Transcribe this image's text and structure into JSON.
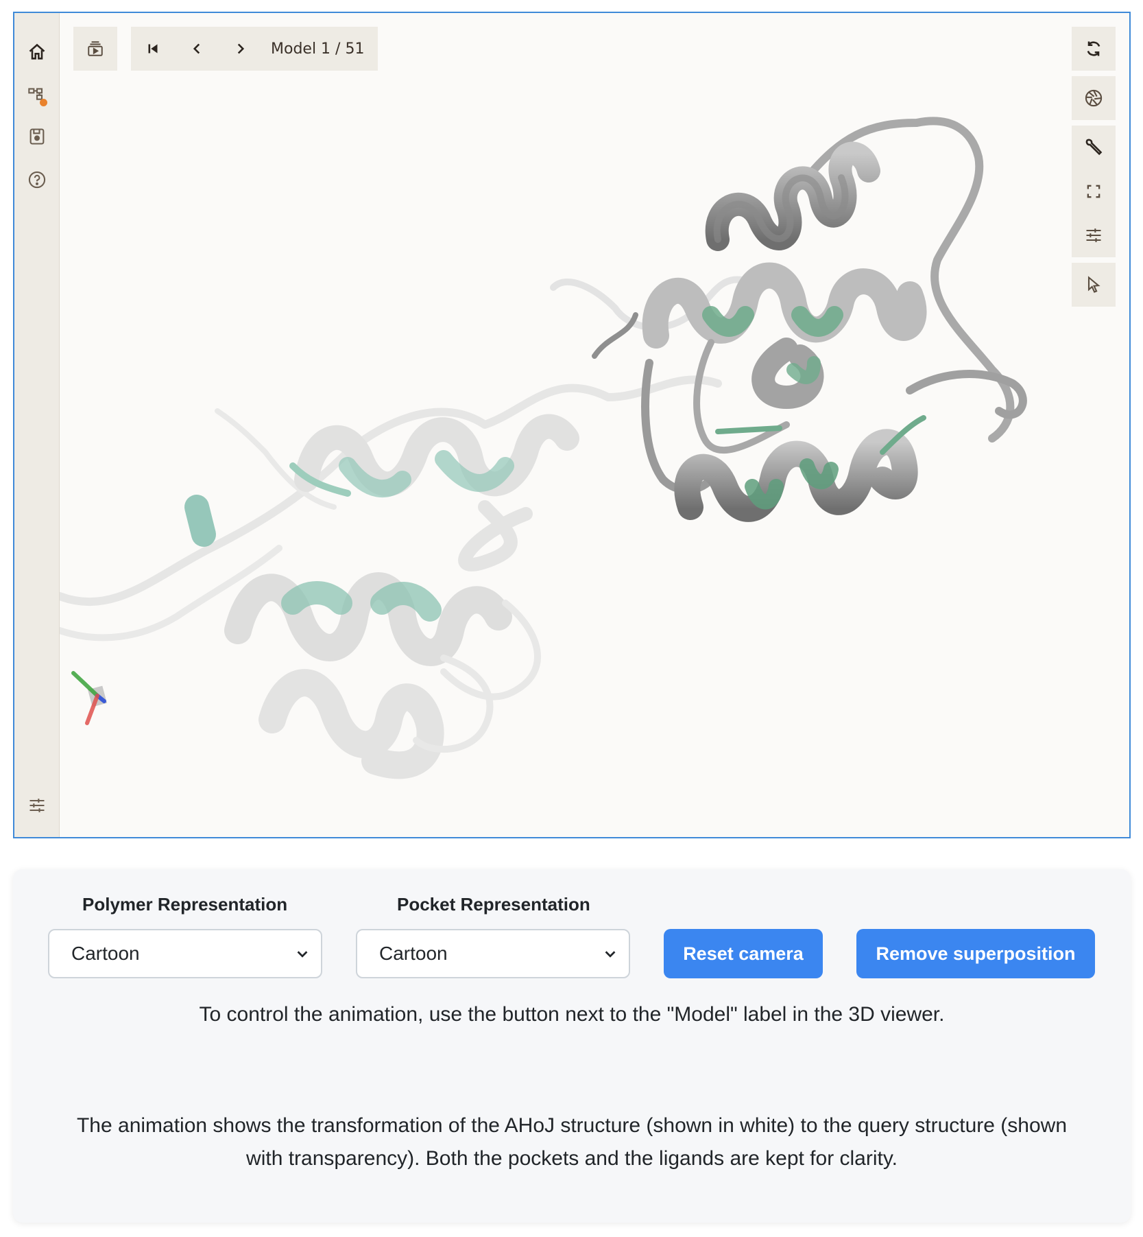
{
  "viewer": {
    "left_rail": {
      "items": [
        {
          "icon": "home-icon"
        },
        {
          "icon": "state-tree-icon"
        },
        {
          "icon": "save-icon"
        },
        {
          "icon": "help-icon"
        }
      ],
      "bottom_icon": "settings-sliders-icon"
    },
    "toolbar": {
      "animation_icon": "animation-icon",
      "model_label": "Model 1 / 51"
    },
    "right_rail": {
      "items": [
        {
          "icon": "reset-rotate-icon"
        },
        {
          "icon": "camera-shutter-icon"
        },
        {
          "icon": "wrench-icon"
        },
        {
          "icon": "fullscreen-icon"
        },
        {
          "icon": "sliders-icon"
        },
        {
          "icon": "pointer-icon"
        }
      ]
    },
    "axes_colors": {
      "x": "#e0524e",
      "y": "#3aa33a",
      "z": "#2b4fd8"
    }
  },
  "controls": {
    "polymer_label": "Polymer Representation",
    "polymer_value": "Cartoon",
    "pocket_label": "Pocket Representation",
    "pocket_value": "Cartoon",
    "reset_camera": "Reset camera",
    "remove_superposition": "Remove superposition"
  },
  "info": {
    "line1": "To control the animation, use the button next to the \"Model\" label in the 3D viewer.",
    "line2a": "The animation shows the transformation of the AHoJ structure (shown in white) to the query structure (shown",
    "line2b": "with transparency). Both the pockets and the ligands are kept for clarity."
  },
  "colors": {
    "accent": "#3b86f0",
    "viewer_border": "#3f8ad8",
    "pocket_green": "#5fa98a"
  }
}
